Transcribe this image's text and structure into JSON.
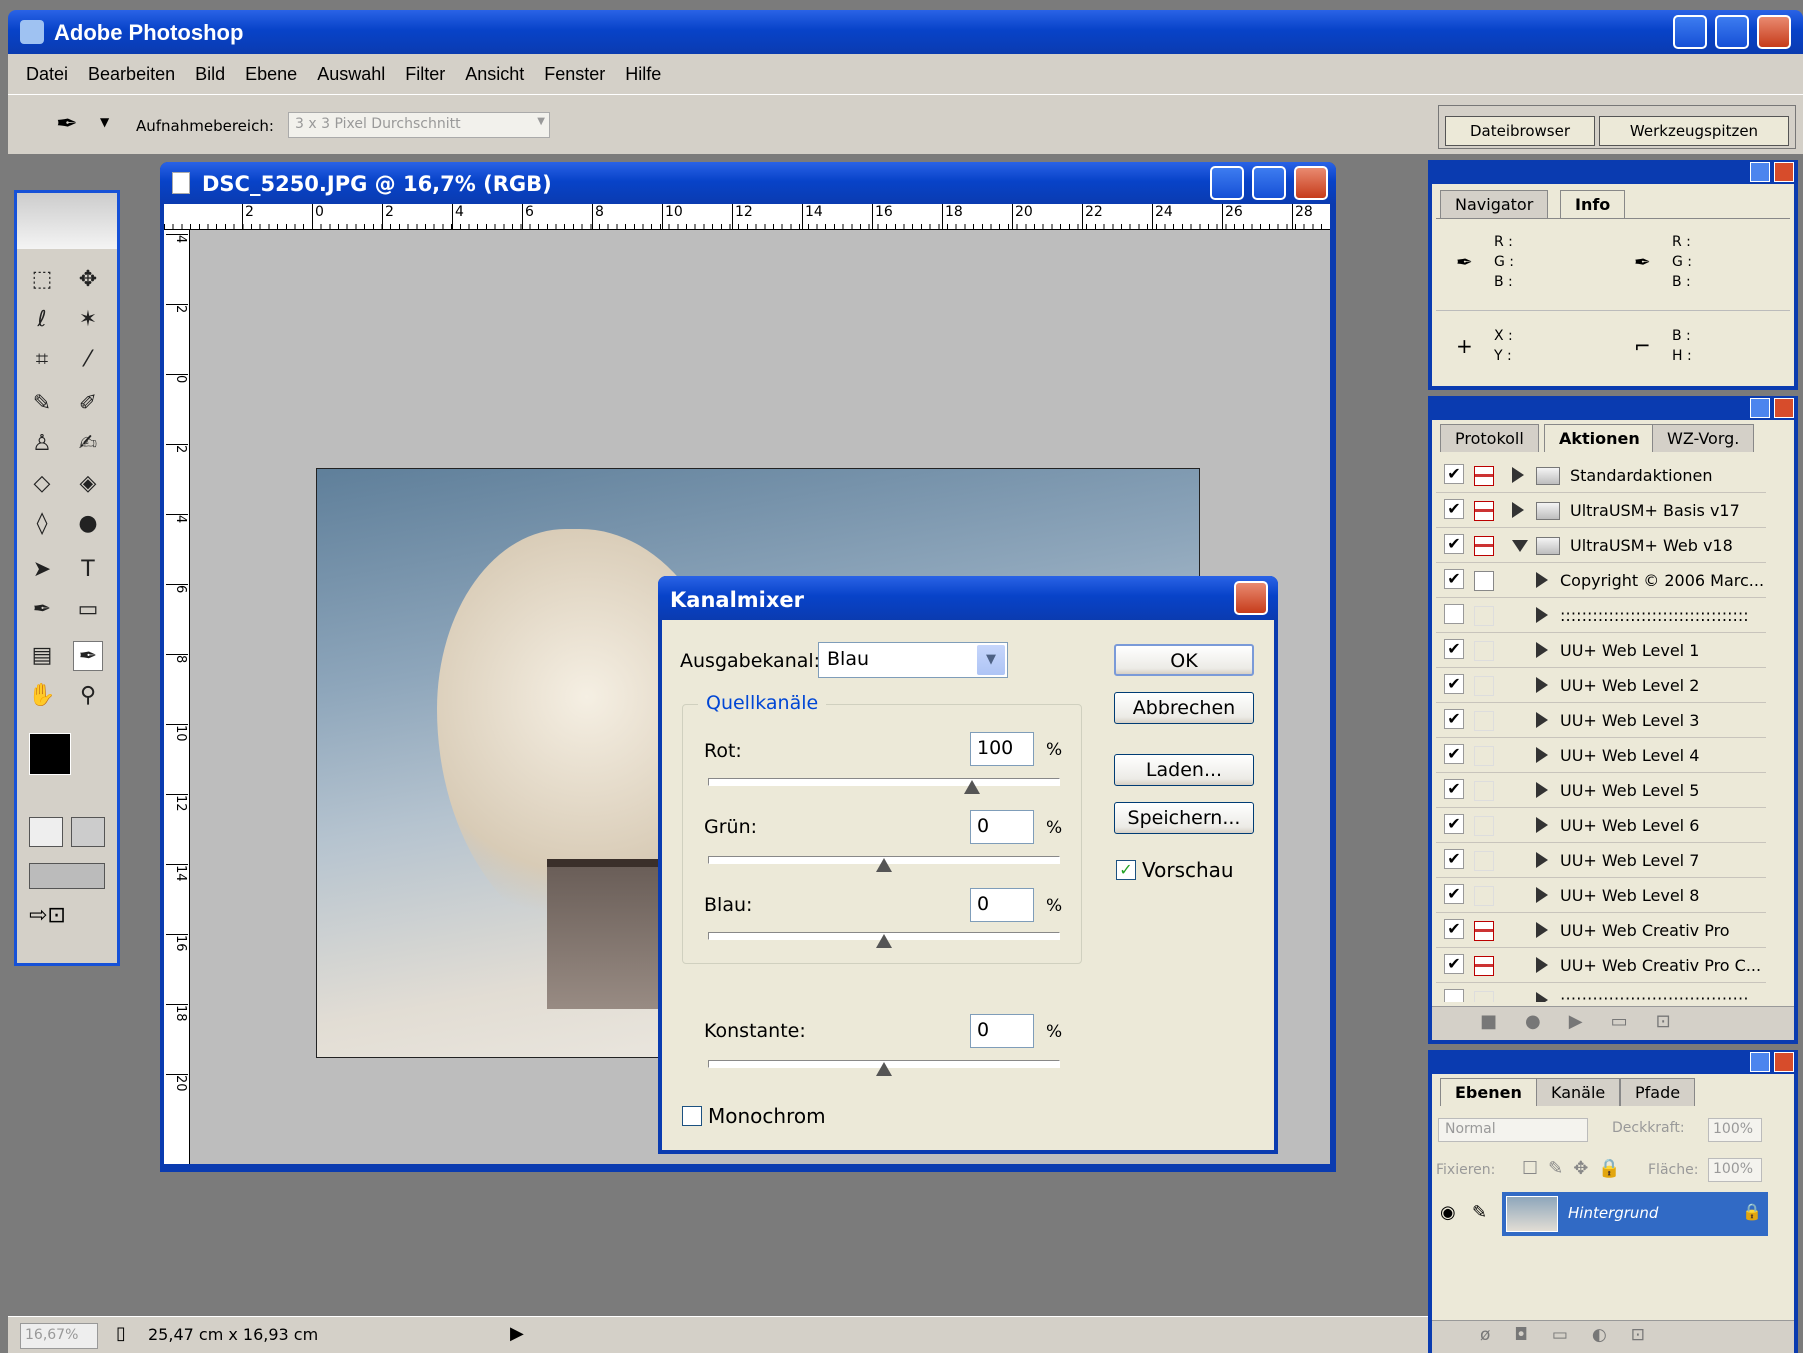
{
  "app": {
    "title": "Adobe Photoshop"
  },
  "menu": [
    "Datei",
    "Bearbeiten",
    "Bild",
    "Ebene",
    "Auswahl",
    "Filter",
    "Ansicht",
    "Fenster",
    "Hilfe"
  ],
  "options": {
    "label": "Aufnahmebereich:",
    "value": "3 x 3 Pixel Durchschnitt"
  },
  "top_tabs": [
    "Dateibrowser",
    "Werkzeugspitzen"
  ],
  "document": {
    "title": "DSC_5250.JPG @ 16,7% (RGB)",
    "ruler_top": [
      "2",
      "0",
      "2",
      "4",
      "6",
      "8",
      "10",
      "12",
      "14",
      "16",
      "18",
      "20",
      "22",
      "24",
      "26",
      "28"
    ],
    "ruler_left": [
      "4",
      "2",
      "0",
      "2",
      "4",
      "6",
      "8",
      "10",
      "12",
      "14",
      "16",
      "18",
      "20"
    ]
  },
  "dialog": {
    "title": "Kanalmixer",
    "output_label": "Ausgabekanal:",
    "output_value": "Blau",
    "group_label": "Quellkanäle",
    "channels": [
      {
        "label": "Rot:",
        "value": "100",
        "unit": "%"
      },
      {
        "label": "Grün:",
        "value": "0",
        "unit": "%"
      },
      {
        "label": "Blau:",
        "value": "0",
        "unit": "%"
      }
    ],
    "constant": {
      "label": "Konstante:",
      "value": "0",
      "unit": "%"
    },
    "monochrome_label": "Monochrom",
    "preview_label": "Vorschau",
    "buttons": {
      "ok": "OK",
      "cancel": "Abbrechen",
      "load": "Laden...",
      "save": "Speichern..."
    }
  },
  "navigator_panel": {
    "tabs": [
      "Navigator",
      "Info"
    ],
    "rgb1": [
      "R :",
      "G :",
      "B :"
    ],
    "rgb2": [
      "R :",
      "G :",
      "B :"
    ],
    "xy": [
      "X :",
      "Y :"
    ],
    "bh": [
      "B :",
      "H :"
    ]
  },
  "actions_panel": {
    "tabs": [
      "Protokoll",
      "Aktionen",
      "WZ-Vorg."
    ],
    "items": [
      "Standardaktionen",
      "UltraUSM+ Basis v17",
      "UltraUSM+ Web v18",
      "Copyright © 2006 Marc...",
      ":::::::::::::::::::::::::::::::::::",
      "UU+ Web Level 1",
      "UU+ Web Level 2",
      "UU+ Web Level 3",
      "UU+ Web Level 4",
      "UU+ Web Level 5",
      "UU+ Web Level 6",
      "UU+ Web Level 7",
      "UU+ Web Level 8",
      "UU+ Web Creativ Pro",
      "UU+ Web Creativ Pro C...",
      ":::::::::::::::::::::::::::::::::::"
    ]
  },
  "layers_panel": {
    "tabs": [
      "Ebenen",
      "Kanäle",
      "Pfade"
    ],
    "blend_mode": "Normal",
    "opacity_label": "Deckkraft:",
    "opacity_value": "100%",
    "lock_label": "Fixieren:",
    "fill_label": "Fläche:",
    "fill_value": "100%",
    "layer_name": "Hintergrund"
  },
  "status": {
    "zoom": "16,67%",
    "size": "25,47 cm x 16,93 cm"
  }
}
